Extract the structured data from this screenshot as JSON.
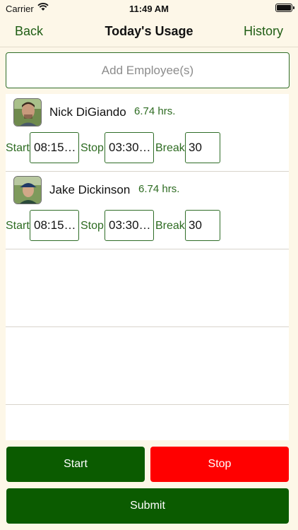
{
  "status_bar": {
    "carrier": "Carrier",
    "time": "11:49 AM"
  },
  "nav": {
    "back": "Back",
    "title": "Today's Usage",
    "history": "History"
  },
  "add_employee": {
    "placeholder": "Add Employee(s)"
  },
  "labels": {
    "start": "Start",
    "stop": "Stop",
    "break": "Break"
  },
  "employees": [
    {
      "name": "Nick DiGiando",
      "hours": "6.74 hrs.",
      "start": "08:15…",
      "stop": "03:30…",
      "break": "30"
    },
    {
      "name": "Jake Dickinson",
      "hours": "6.74 hrs.",
      "start": "08:15…",
      "stop": "03:30…",
      "break": "30"
    }
  ],
  "buttons": {
    "start": "Start",
    "stop": "Stop",
    "submit": "Submit"
  },
  "colors": {
    "accent_green": "#0b5b00",
    "text_green": "#2d6b21",
    "stop_red": "#ff0000",
    "background": "#fdf7e8"
  }
}
